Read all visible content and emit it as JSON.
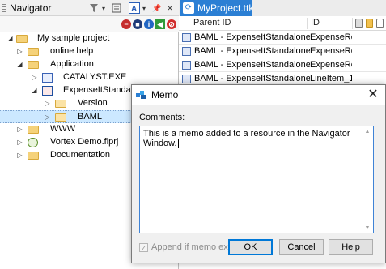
{
  "navigator": {
    "title": "Navigator",
    "tree": [
      {
        "label": "My sample project",
        "level": 0,
        "icon": "folder",
        "expander": "expanded"
      },
      {
        "label": "online help",
        "level": 1,
        "icon": "folder",
        "expander": "collapsed"
      },
      {
        "label": "Application",
        "level": 1,
        "icon": "folder",
        "expander": "expanded"
      },
      {
        "label": "CATALYST.EXE",
        "level": 2,
        "icon": "app-file",
        "expander": "collapsed"
      },
      {
        "label": "ExpenseItStandal",
        "level": 2,
        "icon": "project-file",
        "expander": "expanded"
      },
      {
        "label": "Version",
        "level": 3,
        "icon": "folder-open",
        "expander": "collapsed"
      },
      {
        "label": "BAML",
        "level": 3,
        "icon": "folder-open",
        "expander": "collapsed",
        "selected": true
      },
      {
        "label": "WWW",
        "level": 1,
        "icon": "folder",
        "expander": "collapsed"
      },
      {
        "label": "Vortex Demo.flprj",
        "level": 1,
        "icon": "flprj-file",
        "expander": "collapsed"
      },
      {
        "label": "Documentation",
        "level": 1,
        "icon": "folder",
        "expander": "collapsed"
      }
    ]
  },
  "project": {
    "tab_label": "MyProject.ttk",
    "columns": {
      "parent_id": "Parent ID",
      "id": "ID"
    },
    "rows": [
      {
        "parent": "BAML - ExpenseItStandalone.g.re",
        "id": "ExpenseRepc"
      },
      {
        "parent": "BAML - ExpenseItStandalone.g.re",
        "id": "ExpenseRepc"
      },
      {
        "parent": "BAML - ExpenseItStandalone.g.re",
        "id": "ExpenseRepc"
      },
      {
        "parent": "BAML - ExpenseItStandalone.g.re",
        "id": "LineItem_1"
      }
    ]
  },
  "memo_dialog": {
    "title": "Memo",
    "comments_label": "Comments:",
    "memo_text": "This is a memo added to a resource in the Navigator Window.",
    "append_label": "Append if memo exists",
    "append_checked": true,
    "append_enabled": false,
    "ok_label": "OK",
    "cancel_label": "Cancel",
    "help_label": "Help"
  },
  "colors": {
    "tab_active": "#2b7fd4",
    "selection": "#cce8ff",
    "default_button_border": "#0078d7"
  }
}
